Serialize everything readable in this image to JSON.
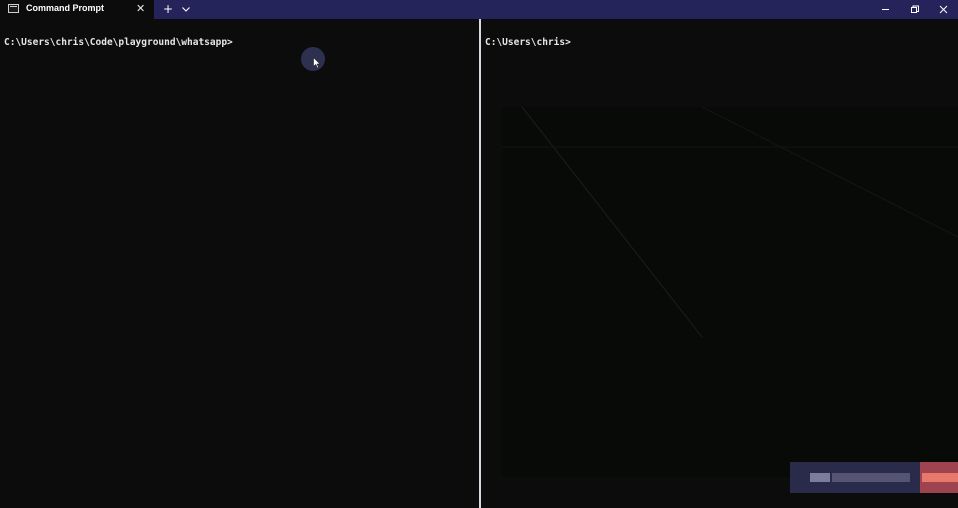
{
  "window": {
    "tab_title": "Command Prompt",
    "tab_close_glyph": "✕",
    "new_tab_glyph": "+",
    "icons": {
      "tab_icon": "terminal-icon",
      "dropdown": "chevron-down-icon",
      "minimize": "minimize-icon",
      "restore": "restore-icon",
      "close": "close-icon",
      "cursor": "mouse-cursor-icon"
    },
    "colors": {
      "titlebar": "#24245a",
      "terminal_bg": "#0c0c0c",
      "text": "#e6e6e6"
    }
  },
  "panes": {
    "left": {
      "prompt": "C:\\Users\\chris\\Code\\playground\\whatsapp>"
    },
    "right": {
      "prompt": "C:\\Users\\chris>"
    }
  }
}
